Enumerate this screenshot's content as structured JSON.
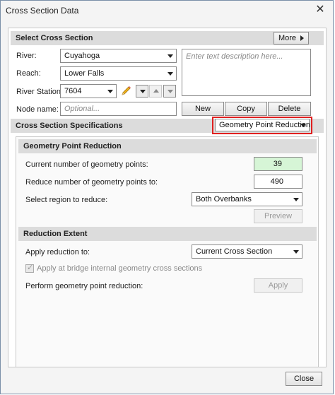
{
  "window": {
    "title": "Cross Section Data",
    "close_glyph": "✕"
  },
  "select_cross_section": {
    "header": "Select Cross Section",
    "more_label": "More",
    "river_label": "River:",
    "river_value": "Cuyahoga",
    "reach_label": "Reach:",
    "reach_value": "Lower Falls",
    "station_label": "River Station:",
    "station_value": "7604",
    "node_label": "Node name:",
    "node_placeholder": "Optional...",
    "description_placeholder": "Enter text description here...",
    "new_label": "New",
    "copy_label": "Copy",
    "delete_label": "Delete"
  },
  "specs": {
    "header": "Cross Section Specifications",
    "mode_value": "Geometry Point Reduction"
  },
  "gpr": {
    "header": "Geometry Point Reduction",
    "current_label": "Current number of geometry points:",
    "current_value": "39",
    "reduce_label": "Reduce number of geometry points to:",
    "reduce_value": "490",
    "region_label": "Select region to reduce:",
    "region_value": "Both Overbanks",
    "preview_label": "Preview"
  },
  "extent": {
    "header": "Reduction Extent",
    "apply_to_label": "Apply reduction to:",
    "apply_to_value": "Current Cross Section",
    "bridge_label": "Apply at bridge internal geometry cross sections",
    "perform_label": "Perform geometry point reduction:",
    "apply_label": "Apply"
  },
  "footer": {
    "close_label": "Close"
  },
  "colors": {
    "highlight": "#e02020",
    "current_points_bg": "#d6f5d6"
  }
}
